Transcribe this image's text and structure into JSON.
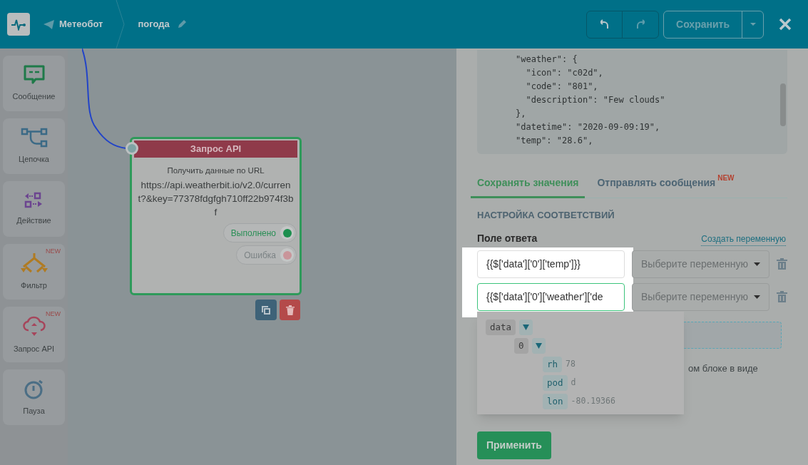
{
  "header": {
    "bot_name": "Метеобот",
    "flow_name": "погода",
    "save_button": "Сохранить"
  },
  "sidebar": {
    "items": [
      {
        "kind": "message",
        "label": "Сообщение"
      },
      {
        "kind": "chain",
        "label": "Цепочка"
      },
      {
        "kind": "action",
        "label": "Действие"
      },
      {
        "kind": "filter",
        "label": "Фильтр",
        "badge": "NEW"
      },
      {
        "kind": "api",
        "label": "Запрос API",
        "badge": "NEW"
      },
      {
        "kind": "pause",
        "label": "Пауза"
      }
    ]
  },
  "node": {
    "title": "Запрос API",
    "subtitle": "Получить данные по URL",
    "url": "https://api.weatherbit.io/v2.0/current?&key=77378fdgfgh710ff22b974f3bf",
    "outputs": [
      {
        "kind": "success",
        "label": "Выполнено"
      },
      {
        "kind": "error",
        "label": "Ошибка"
      }
    ]
  },
  "panel": {
    "code_lines": [
      "\"weather\": {",
      "  \"icon\": \"c02d\",",
      "  \"code\": \"801\",",
      "  \"description\": \"Few clouds\"",
      "},",
      "\"datetime\": \"2020-09-09:19\",",
      "\"temp\": \"28.6\","
    ],
    "tabs": [
      {
        "label": "Сохранять значения",
        "selected": true
      },
      {
        "label": "Отправлять сообщения",
        "selected": false,
        "badge": "NEW"
      }
    ],
    "section_title": "НАСТРОЙКА СООТВЕТСТВИЙ",
    "field_label": "Поле ответа",
    "create_link": "Создать переменную",
    "mappings": [
      {
        "value": "{{$['data']['0']['temp']}}",
        "placeholder": "Выберите переменную",
        "focused": false
      },
      {
        "value": "{{$['data']['0']['weather']['de",
        "placeholder": "Выберите переменную",
        "focused": true
      }
    ],
    "hint_fragment": "ом блоке в виде",
    "tree": [
      {
        "key": "data",
        "expanded": true,
        "children": [
          {
            "key": "0",
            "expanded": true,
            "children": [
              {
                "key": "rh",
                "value": "78"
              },
              {
                "key": "pod",
                "value": "d"
              },
              {
                "key": "lon",
                "value": "-80.19366"
              }
            ]
          }
        ]
      }
    ],
    "apply_button": "Применить"
  }
}
